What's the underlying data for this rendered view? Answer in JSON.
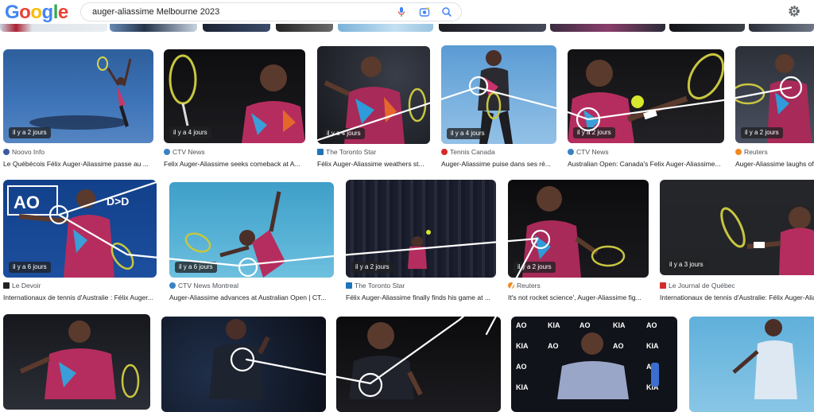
{
  "header": {
    "logo_letters": [
      "G",
      "o",
      "o",
      "g",
      "l",
      "e"
    ],
    "logo_colors": [
      "#4285F4",
      "#EA4335",
      "#FBBC05",
      "#4285F4",
      "#34A853",
      "#EA4335"
    ],
    "search_value": "auger-aliassime Melbourne 2023",
    "icons": [
      "microphone-icon",
      "camera-icon",
      "search-icon",
      "gear-icon"
    ]
  },
  "results": [
    {
      "badge": "il y a 2 jours",
      "source": "Noovo Info",
      "title": "Le Québécois Félix Auger-Aliassime passe au ..."
    },
    {
      "badge": "il y a 4 jours",
      "source": "CTV News",
      "title": "Felix Auger-Aliassime seeks comeback at A..."
    },
    {
      "badge": "il y a 4 jours",
      "source": "The Toronto Star",
      "title": "Félix Auger-Aliassime weathers st..."
    },
    {
      "badge": "il y a 4 jours",
      "source": "Tennis Canada",
      "title": "Auger-Aliassime puise dans ses ré..."
    },
    {
      "badge": "il y a 2 jours",
      "source": "CTV News",
      "title": "Australian Open: Canada's Felix Auger-Aliassime..."
    },
    {
      "badge": "il y a 2 jours",
      "source": "Reuters",
      "title": "Auger-Aliassime laughs of..."
    },
    {
      "badge": "il y a 6 jours",
      "source": "Le Devoir",
      "title": "Internationaux de tennis d'Australie : Félix Auger..."
    },
    {
      "badge": "il y a 6 jours",
      "source": "CTV News Montreal",
      "title": "Auger-Aliassime advances at Australian Open | CT..."
    },
    {
      "badge": "il y a 2 jours",
      "source": "The Toronto Star",
      "title": "Félix Auger-Aliassime finally finds his game at ..."
    },
    {
      "badge": "il y a 2 jours",
      "source": "Reuters",
      "title": "It's not rocket science', Auger-Aliassime fig..."
    },
    {
      "badge": "il y a 3 jours",
      "source": "Le Journal de Québec",
      "title": "Internationaux de tennis d'Australie: Félix Auger-Aliassime..."
    }
  ]
}
